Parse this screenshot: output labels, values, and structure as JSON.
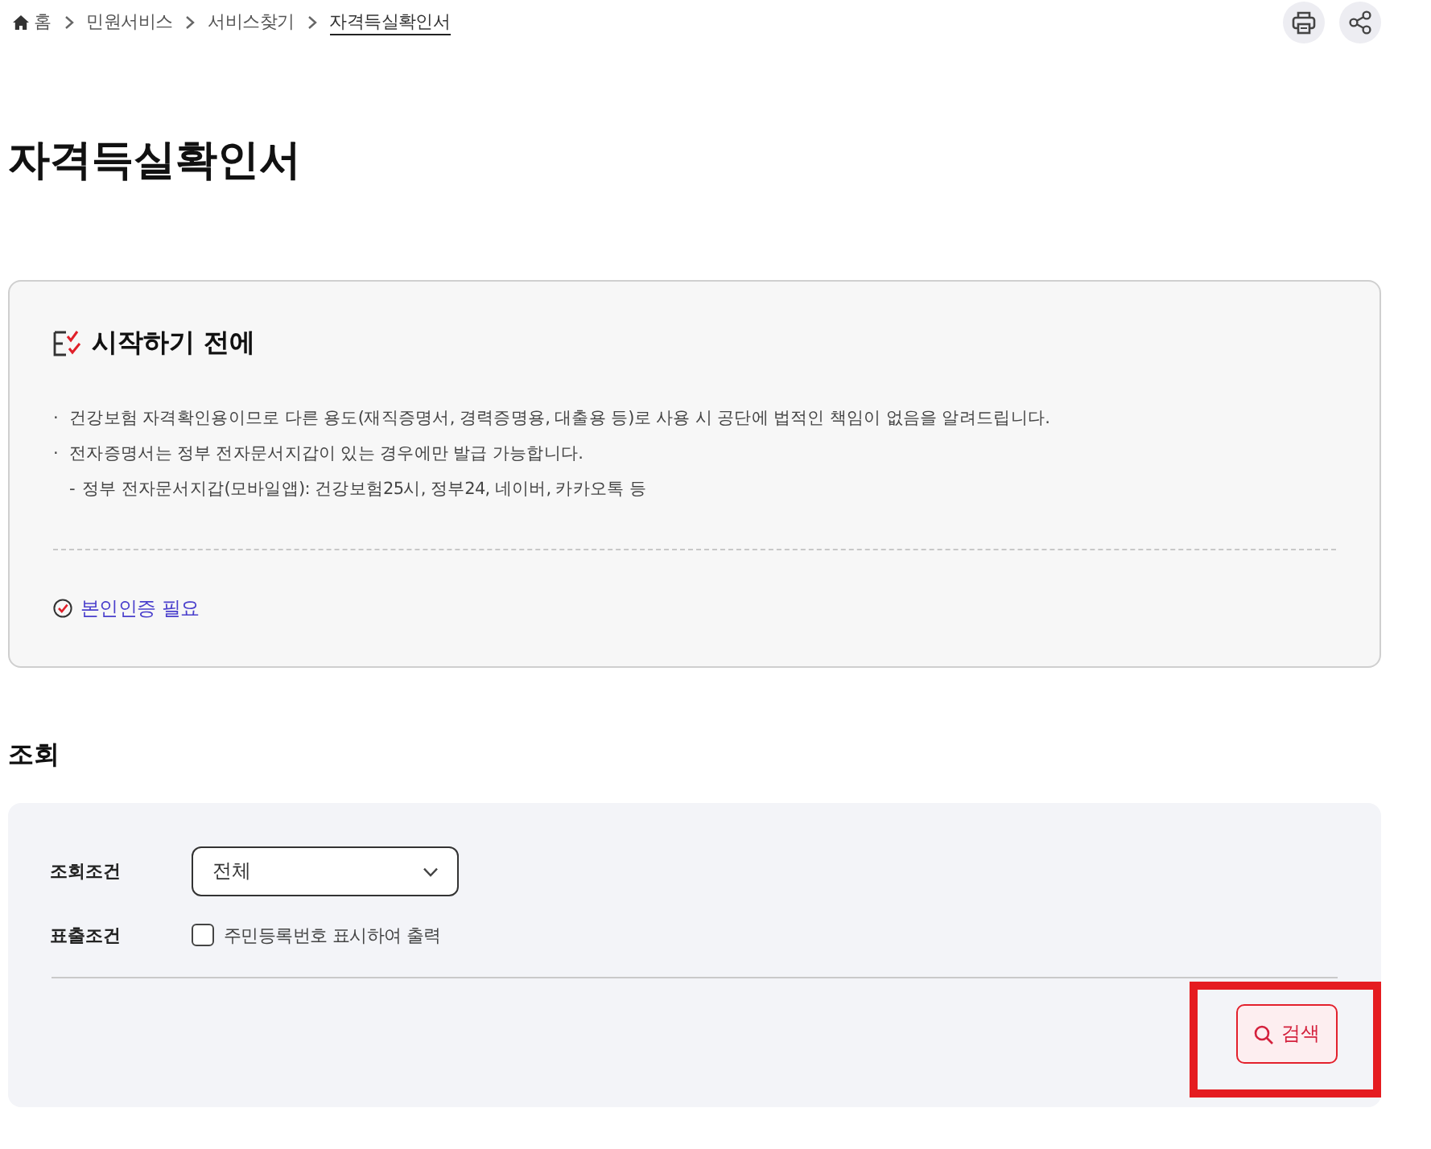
{
  "breadcrumb": [
    {
      "label": "홈",
      "selected": false
    },
    {
      "label": "민원서비스",
      "selected": false
    },
    {
      "label": "서비스찾기",
      "selected": false
    },
    {
      "label": "자격득실확인서",
      "selected": true
    }
  ],
  "page_title": "자격득실확인서",
  "notice": {
    "title": "시작하기 전에",
    "items": [
      {
        "marker": "·",
        "text": "건강보험 자격확인용이므로 다른 용도(재직증명서, 경력증명용, 대출용 등)로 사용 시 공단에 법적인 책임이 없음을 알려드립니다."
      },
      {
        "marker": "·",
        "text": "전자증명서는 정부 전자문서지갑이 있는 경우에만 발급 가능합니다.",
        "children": [
          {
            "marker": "-",
            "text": "정부 전자문서지갑(모바일앱): 건강보험25시, 정부24, 네이버, 카카오톡 등"
          }
        ]
      }
    ],
    "requirement": "본인인증 필요"
  },
  "query": {
    "heading": "조회",
    "fields": [
      {
        "label": "조회조건",
        "kind": "select",
        "value": "전체"
      },
      {
        "label": "표출조건",
        "kind": "checkbox",
        "option": "주민등록번호 표시하여 출력",
        "checked": false
      }
    ],
    "search_button": {
      "label": "검색",
      "highlighted": true
    }
  }
}
